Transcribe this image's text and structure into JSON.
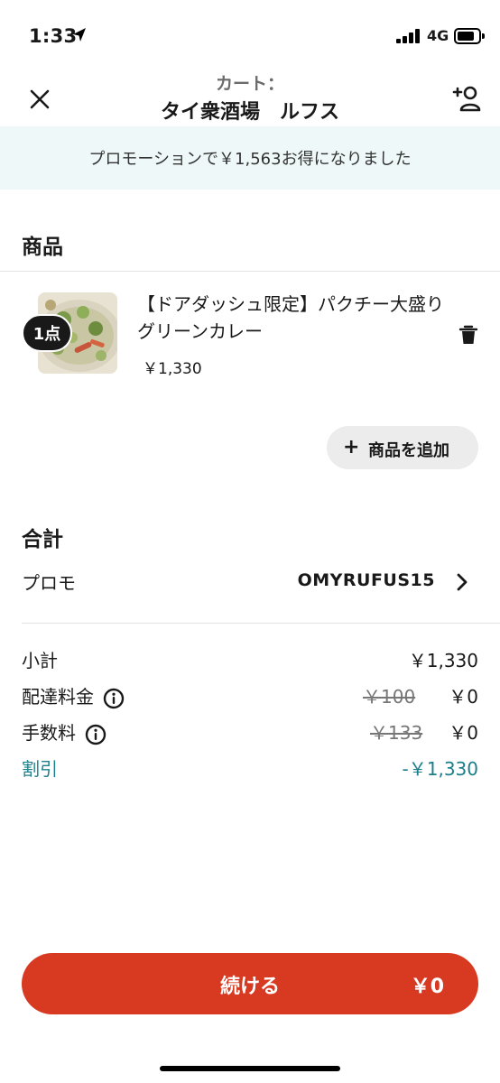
{
  "status_bar": {
    "time": "1:33",
    "network": "4G"
  },
  "header": {
    "subtitle": "カート：",
    "title": "タイ衆酒場　ルフス"
  },
  "promo_banner": {
    "text": "プロモーションで￥1,563お得になりました"
  },
  "items_section": {
    "title": "商品",
    "items": [
      {
        "quantity": "1点",
        "name": "【ドアダッシュ限定】パクチー大盛りグリーンカレー",
        "price": "￥1,330"
      }
    ],
    "add_button": {
      "icon": "+",
      "label": "商品を追加"
    }
  },
  "total_section": {
    "title": "合計",
    "promo": {
      "label": "プロモ",
      "code": "OMYRUFUS15"
    },
    "rows": [
      {
        "label": "小計",
        "value": "￥1,330"
      },
      {
        "label": "配達料金",
        "original": "￥100",
        "value": "￥0"
      },
      {
        "label": "手数料",
        "original": "￥133",
        "value": "￥0"
      },
      {
        "label": "割引",
        "value": "-￥1,330"
      }
    ]
  },
  "continue_button": {
    "label": "続ける",
    "total": "￥0"
  },
  "colors": {
    "accent": "#d73a21",
    "discount": "#1b7f8a",
    "banner_bg": "#eef8f8"
  }
}
